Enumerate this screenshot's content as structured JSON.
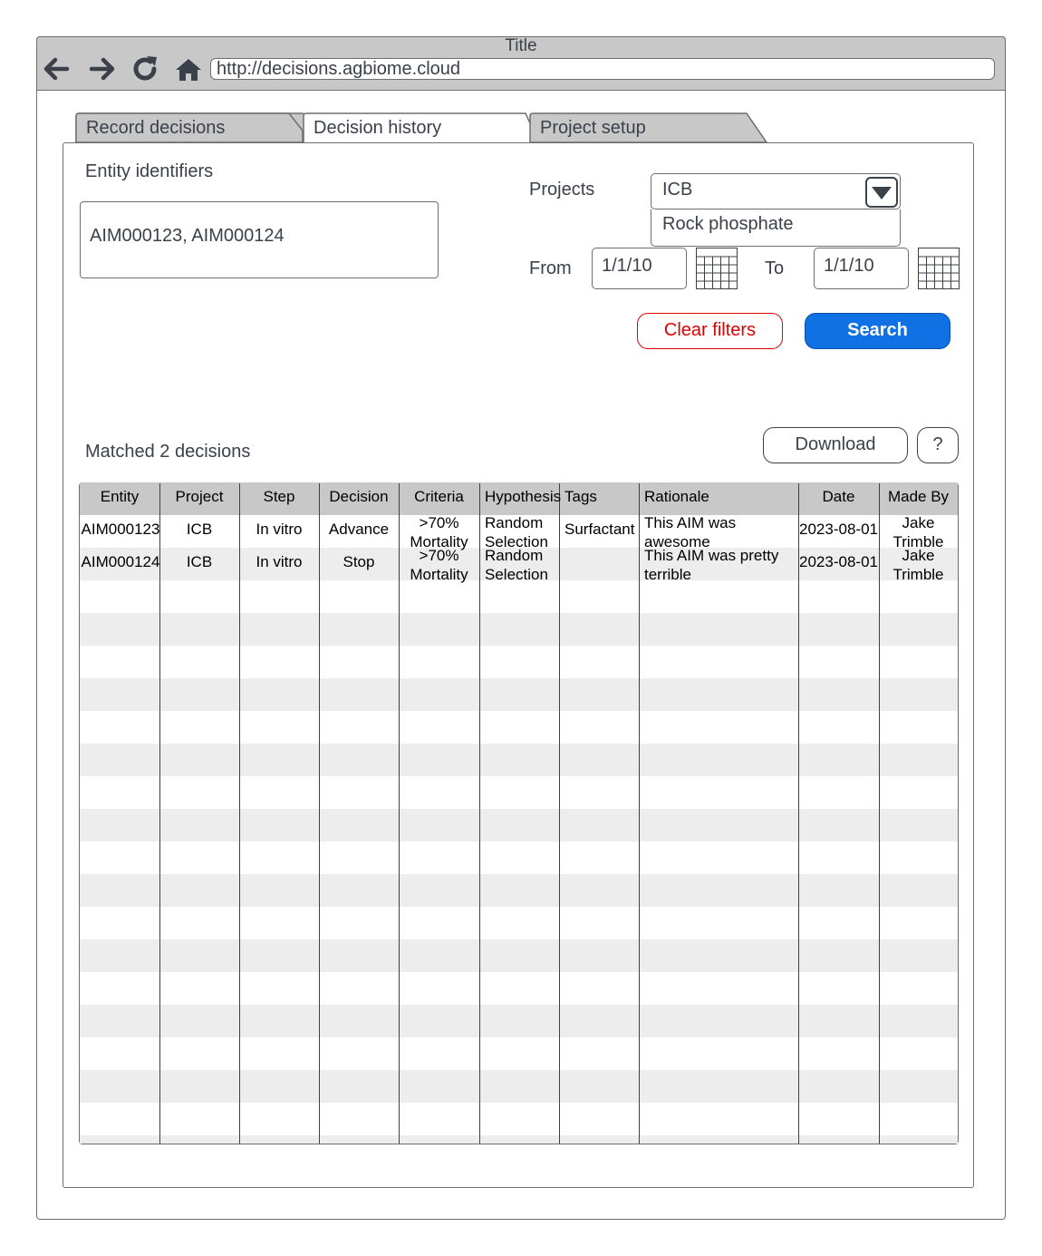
{
  "window": {
    "title": "Title",
    "url": "http://decisions.agbiome.cloud"
  },
  "tabs": [
    {
      "label": "Record decisions",
      "active": false
    },
    {
      "label": "Decision history",
      "active": true
    },
    {
      "label": "Project setup",
      "active": false
    }
  ],
  "filters": {
    "entity_label": "Entity identifiers",
    "entity_value": "AIM000123, AIM000124",
    "projects_label": "Projects",
    "projects_selected": "ICB",
    "projects_options": [
      "Rock phosphate"
    ],
    "from_label": "From",
    "from_value": "1/1/10",
    "to_label": "To",
    "to_value": "1/1/10",
    "clear_label": "Clear filters",
    "search_label": "Search"
  },
  "results": {
    "summary": "Matched 2 decisions",
    "download_label": "Download",
    "help_label": "?",
    "columns": [
      "Entity",
      "Project",
      "Step",
      "Decision",
      "Criteria",
      "Hypothesis",
      "Tags",
      "Rationale",
      "Date",
      "Made By"
    ],
    "rows": [
      {
        "entity": "AIM000123",
        "project": "ICB",
        "step": "In vitro",
        "decision": "Advance",
        "criteria": ">70% Mortality",
        "hypothesis": "Random Selection",
        "tags": "Surfactant",
        "rationale": "This AIM was awesome",
        "date": "2023-08-01",
        "made_by": "Jake Trimble"
      },
      {
        "entity": "AIM000124",
        "project": "ICB",
        "step": "In vitro",
        "decision": "Stop",
        "criteria": ">70% Mortality",
        "hypothesis": "Random Selection",
        "tags": "",
        "rationale": "This AIM was pretty terrible",
        "date": "2023-08-01",
        "made_by": "Jake Trimble"
      }
    ]
  },
  "colors": {
    "primary": "#1071e5",
    "danger": "#e00000",
    "chrome": "#c8c8c8",
    "text": "#3a414a"
  }
}
